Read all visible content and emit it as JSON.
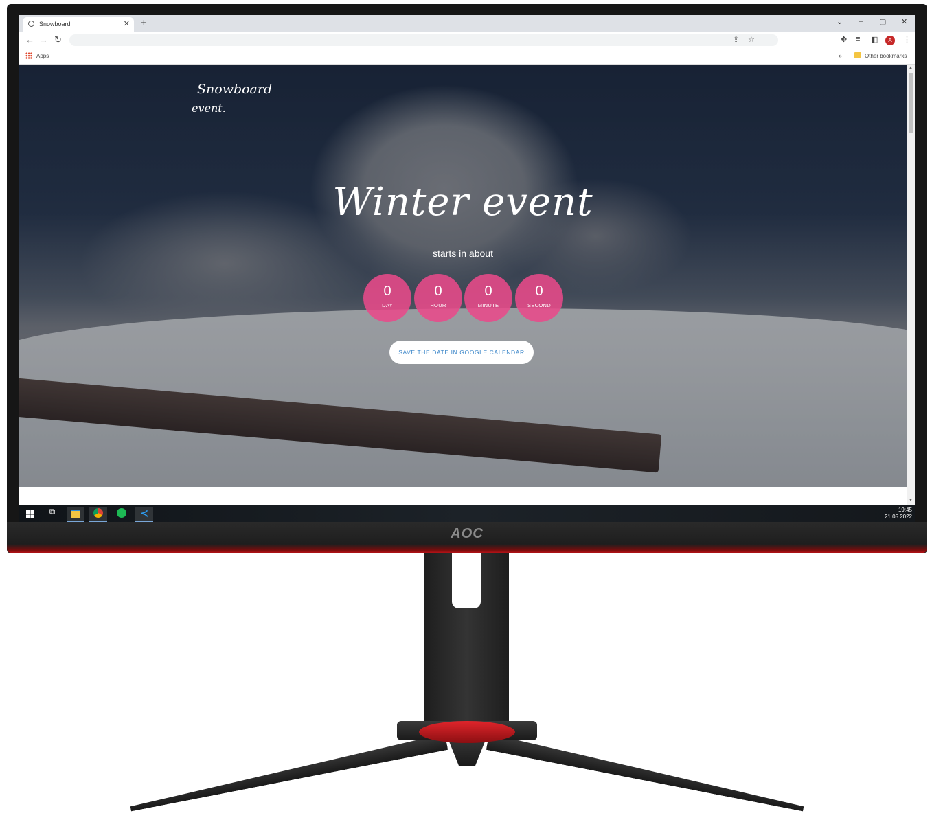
{
  "browser": {
    "tab_title": "Snowboard",
    "tab_close": "✕",
    "new_tab": "+",
    "window_controls": [
      "⌄",
      "–",
      "▢",
      "✕"
    ],
    "bookmarks": {
      "apps_label": "Apps",
      "more": "»",
      "other_label": "Other bookmarks"
    },
    "profile_initial": "A"
  },
  "page": {
    "logo_line1": "Snowboard",
    "logo_line2": "event.",
    "hero_title": "Winter event",
    "subtitle": "starts in about",
    "countdown": [
      {
        "value": "0",
        "unit": "DAY"
      },
      {
        "value": "0",
        "unit": "HOUR"
      },
      {
        "value": "0",
        "unit": "MINUTE"
      },
      {
        "value": "0",
        "unit": "SECOND"
      }
    ],
    "calendar_button": "SAVE THE DATE IN GOOGLE CALENDAR",
    "accent_color": "#e84a8a"
  },
  "taskbar": {
    "icons": [
      "windows-start-icon",
      "task-view-icon",
      "file-explorer-icon",
      "chrome-icon",
      "spotify-icon",
      "vscode-icon"
    ],
    "time": "19:45",
    "date": "21.05.2022"
  },
  "monitor": {
    "brand": "AOC"
  }
}
